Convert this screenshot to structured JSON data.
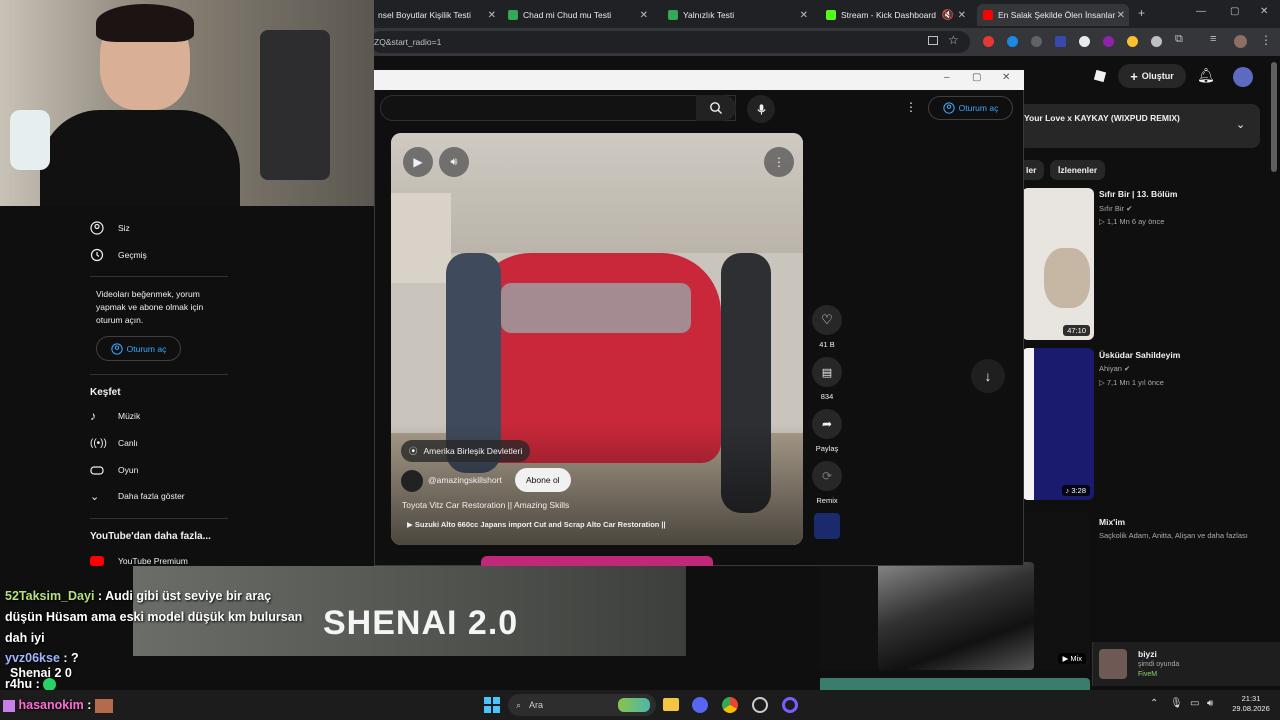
{
  "browser": {
    "tabs": [
      {
        "title": "nsel Boyutlar Kişilik Testi",
        "color": "#4285f4"
      },
      {
        "title": "Chad mi Chud mu Testi",
        "color": "#34a853"
      },
      {
        "title": "Yalnızlık Testi",
        "color": "#34a853"
      },
      {
        "title": "Stream - Kick Dashboard",
        "color": "#53fc18"
      },
      {
        "title": "En Salak Şekilde Ölen İnsanlar",
        "color": "#ff0000"
      }
    ],
    "url": "ZQ&start_radio=1",
    "new_tab": "+"
  },
  "youtube": {
    "create_label": "Oluştur",
    "signin_label": "Oturum aç",
    "now_playing": "Your Love x KAYKAY (WIXPUD REMIX)",
    "chips": [
      "ler",
      "İzlenenler"
    ],
    "videos": [
      {
        "title": "Sıfır Bir | 13. Bölüm",
        "channel": "Sıfır Bir",
        "meta": "1,1 Mn   6 ay önce",
        "duration": "47:10"
      },
      {
        "title": "Üsküdar Sahildeyim",
        "channel": "Ahiyan",
        "meta": "7,1 Mn   1 yıl önce",
        "duration": "3:28"
      },
      {
        "title": "Mix'im",
        "channel": "Saçkolik Adam, Anitta, Alişan ve daha fazlası",
        "meta": "",
        "duration": "Mix"
      }
    ]
  },
  "sidebar": {
    "items_top": [
      {
        "label": "Siz",
        "icon": "user-icon"
      },
      {
        "label": "Geçmiş",
        "icon": "history-icon"
      }
    ],
    "signin_prompt": "Videoları beğenmek, yorum yapmak ve abone olmak için oturum açın.",
    "signin_label": "Oturum aç",
    "explore_title": "Keşfet",
    "explore_items": [
      {
        "label": "Müzik",
        "icon": "music-icon"
      },
      {
        "label": "Canlı",
        "icon": "live-icon"
      },
      {
        "label": "Oyun",
        "icon": "gaming-icon"
      },
      {
        "label": "Daha fazla göster",
        "icon": "chevron-down-icon"
      }
    ],
    "more_title": "YouTube'dan daha fazla...",
    "premium_label": "YouTube Premium"
  },
  "popup": {
    "signin_label": "Oturum aç",
    "location": "Amerika Birleşik Devletleri",
    "channel": "@amazingskillshort",
    "subscribe_label": "Abone ol",
    "video_title": "Toyota Vitz Car Restoration || Amazing Skills",
    "related": "Suzuki Alto 660cc Japans import Cut and Scrap Alto Car Restoration ||",
    "likes": "41 B",
    "comments": "834",
    "share_label": "Paylaş",
    "remix_label": "Remix"
  },
  "chat": {
    "messages": [
      {
        "user": "52Taksim_Dayi",
        "user_color": "#b5e07c",
        "text": "Audi gibi üst seviye bir araç düşün Hüsam ama eski model düşük km bulursan dah iyi"
      },
      {
        "user": "yvz06kse",
        "user_color": "#9fb6ff",
        "text": "?"
      },
      {
        "user": "r4hu",
        "user_color": "#ffffff",
        "text": ""
      },
      {
        "user": "hasanokim",
        "user_color": "#ff6ad5",
        "text": ""
      }
    ],
    "overlay_text": "Shenai 2 0",
    "banner_text": "SHENAI 2.0"
  },
  "friend": {
    "name": "biyzi",
    "status": "şimdi oyunda",
    "game": "FiveM"
  },
  "taskbar": {
    "search_placeholder": "Ara",
    "time": "21:31",
    "date": "29.08.2026"
  }
}
